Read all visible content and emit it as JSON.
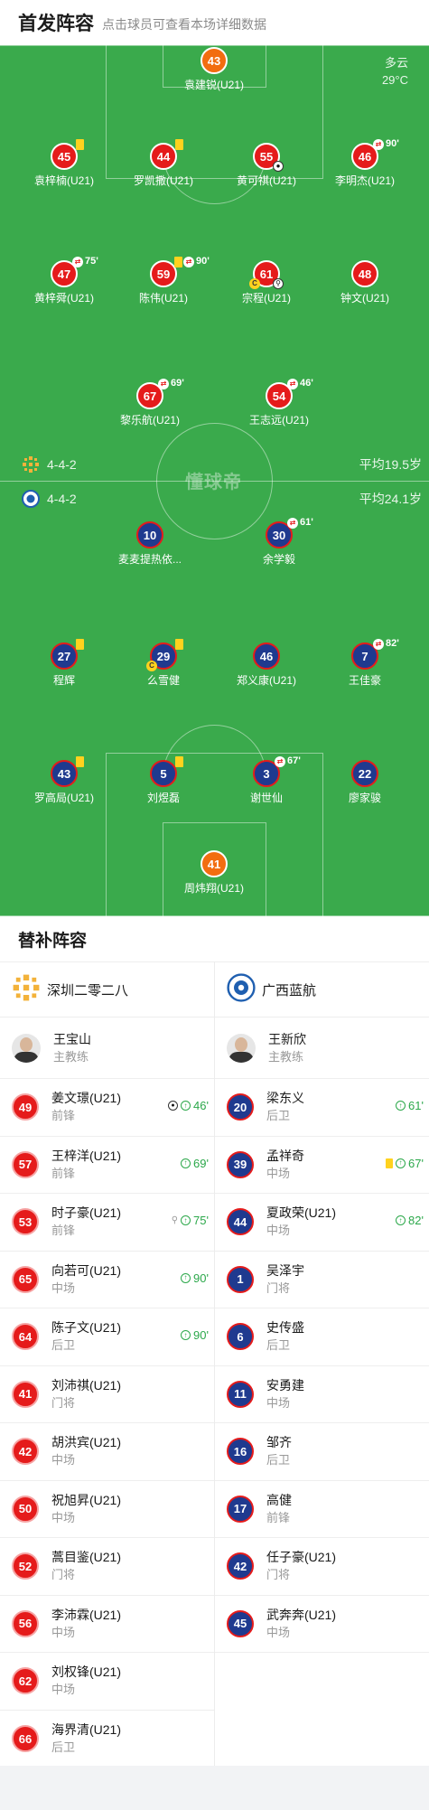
{
  "header": {
    "title": "首发阵容",
    "subtitle": "点击球员可查看本场详细数据"
  },
  "weather": {
    "condition": "多云",
    "temp": "29°C"
  },
  "watermark": "懂球帝",
  "home_formation": {
    "formation": "4-4-2",
    "avg_age": "平均19.5岁"
  },
  "away_formation": {
    "formation": "4-4-2",
    "avg_age": "平均24.1岁"
  },
  "home_players": [
    {
      "num": "43",
      "name": "袁建锐(U21)",
      "events": []
    },
    {
      "num": "45",
      "name": "袁梓楠(U21)",
      "events": [
        "yellow"
      ]
    },
    {
      "num": "44",
      "name": "罗凯撒(U21)",
      "events": [
        "yellow"
      ]
    },
    {
      "num": "55",
      "name": "黄可祺(U21)",
      "events": [
        "goal"
      ]
    },
    {
      "num": "46",
      "name": "李明杰(U21)",
      "events": [
        "sub"
      ],
      "minute": "90'"
    },
    {
      "num": "47",
      "name": "黄梓舜(U21)",
      "events": [
        "sub"
      ],
      "minute": "75'"
    },
    {
      "num": "59",
      "name": "陈伟(U21)",
      "events": [
        "yellow",
        "sub"
      ],
      "minute": "90'"
    },
    {
      "num": "61",
      "name": "宗程(U21)",
      "events": [
        "captain",
        "assist"
      ]
    },
    {
      "num": "48",
      "name": "钟文(U21)",
      "events": []
    },
    {
      "num": "67",
      "name": "黎乐航(U21)",
      "events": [
        "sub"
      ],
      "minute": "69'"
    },
    {
      "num": "54",
      "name": "王志远(U21)",
      "events": [
        "sub"
      ],
      "minute": "46'"
    }
  ],
  "away_players": [
    {
      "num": "10",
      "name": "麦麦提热依...",
      "events": []
    },
    {
      "num": "30",
      "name": "余学毅",
      "events": [
        "sub"
      ],
      "minute": "61'"
    },
    {
      "num": "27",
      "name": "程辉",
      "events": [
        "yellow"
      ]
    },
    {
      "num": "29",
      "name": "么雪健",
      "events": [
        "yellow",
        "captain"
      ]
    },
    {
      "num": "46",
      "name": "郑义康(U21)",
      "events": []
    },
    {
      "num": "7",
      "name": "王佳豪",
      "events": [
        "sub"
      ],
      "minute": "82'"
    },
    {
      "num": "43",
      "name": "罗高局(U21)",
      "events": [
        "yellow"
      ]
    },
    {
      "num": "5",
      "name": "刘煜磊",
      "events": [
        "yellow"
      ]
    },
    {
      "num": "3",
      "name": "谢世仙",
      "events": [
        "sub"
      ],
      "minute": "67'"
    },
    {
      "num": "22",
      "name": "廖家骏",
      "events": []
    },
    {
      "num": "41",
      "name": "周炜翔(U21)",
      "events": []
    }
  ],
  "subs_section": {
    "title": "替补阵容"
  },
  "home_subs": {
    "team": "深圳二零二八",
    "coach": {
      "name": "王宝山",
      "role": "主教练"
    },
    "players": [
      {
        "num": "49",
        "name": "姜文璟(U21)",
        "pos": "前锋",
        "events": [
          "goal",
          "sub"
        ],
        "minute": "46'"
      },
      {
        "num": "57",
        "name": "王梓洋(U21)",
        "pos": "前锋",
        "events": [
          "sub"
        ],
        "minute": "69'"
      },
      {
        "num": "53",
        "name": "时子豪(U21)",
        "pos": "前锋",
        "events": [
          "assist",
          "sub"
        ],
        "minute": "75'"
      },
      {
        "num": "65",
        "name": "向若可(U21)",
        "pos": "中场",
        "events": [
          "sub"
        ],
        "minute": "90'"
      },
      {
        "num": "64",
        "name": "陈子文(U21)",
        "pos": "后卫",
        "events": [
          "sub"
        ],
        "minute": "90'"
      },
      {
        "num": "41",
        "name": "刘沛祺(U21)",
        "pos": "门将",
        "events": []
      },
      {
        "num": "42",
        "name": "胡洪宾(U21)",
        "pos": "中场",
        "events": []
      },
      {
        "num": "50",
        "name": "祝旭昇(U21)",
        "pos": "中场",
        "events": []
      },
      {
        "num": "52",
        "name": "蒿目鉴(U21)",
        "pos": "门将",
        "events": []
      },
      {
        "num": "56",
        "name": "李沛霖(U21)",
        "pos": "中场",
        "events": []
      },
      {
        "num": "62",
        "name": "刘权锋(U21)",
        "pos": "中场",
        "events": []
      },
      {
        "num": "66",
        "name": "海界清(U21)",
        "pos": "后卫",
        "events": []
      }
    ]
  },
  "away_subs": {
    "team": "广西蓝航",
    "coach": {
      "name": "王新欣",
      "role": "主教练"
    },
    "players": [
      {
        "num": "20",
        "name": "梁东义",
        "pos": "后卫",
        "events": [
          "sub"
        ],
        "minute": "61'"
      },
      {
        "num": "39",
        "name": "孟祥奇",
        "pos": "中场",
        "events": [
          "yellow",
          "sub"
        ],
        "minute": "67'"
      },
      {
        "num": "44",
        "name": "夏政荣(U21)",
        "pos": "中场",
        "events": [
          "sub"
        ],
        "minute": "82'"
      },
      {
        "num": "1",
        "name": "吴泽宇",
        "pos": "门将",
        "events": []
      },
      {
        "num": "6",
        "name": "史传盛",
        "pos": "后卫",
        "events": []
      },
      {
        "num": "11",
        "name": "安勇建",
        "pos": "中场",
        "events": []
      },
      {
        "num": "16",
        "name": "邹齐",
        "pos": "后卫",
        "events": []
      },
      {
        "num": "17",
        "name": "高健",
        "pos": "前锋",
        "events": []
      },
      {
        "num": "42",
        "name": "任子豪(U21)",
        "pos": "门将",
        "events": []
      },
      {
        "num": "45",
        "name": "武奔奔(U21)",
        "pos": "中场",
        "events": []
      }
    ]
  },
  "icons": {
    "sub_in": "arrow-up-icon",
    "goal": "football-icon",
    "yellow": "yellow-card-icon",
    "captain": "captain-badge-icon",
    "assist": "boot-icon"
  }
}
